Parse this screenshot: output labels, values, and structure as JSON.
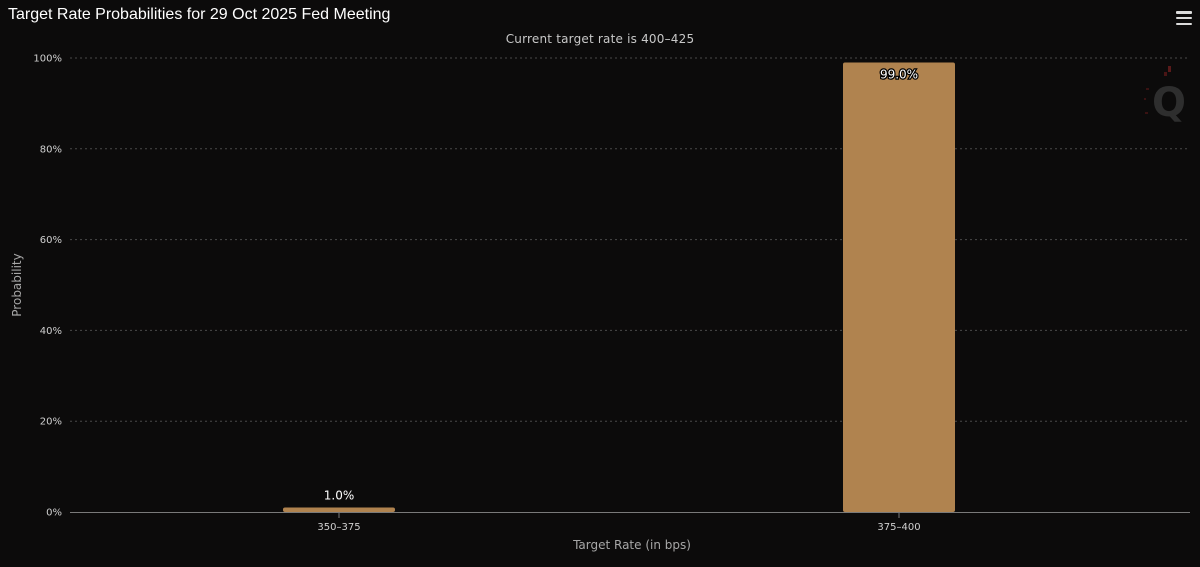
{
  "header": {
    "title": "Target Rate Probabilities for 29 Oct 2025 Fed Meeting",
    "subtitle": "Current target rate is 400–425",
    "menu_icon": "hamburger-menu-icon",
    "watermark_letter": "Q"
  },
  "colors": {
    "background": "#0c0b0b",
    "bar": "#b0834f",
    "grid": "#4a4a4a",
    "axis": "#7a7a7a"
  },
  "chart_data": {
    "type": "bar",
    "title": "Target Rate Probabilities for 29 Oct 2025 Fed Meeting",
    "subtitle": "Current target rate is 400–425",
    "xlabel": "Target Rate (in bps)",
    "ylabel": "Probability",
    "categories": [
      "350–375",
      "375–400"
    ],
    "values": [
      1.0,
      99.0
    ],
    "data_labels": [
      "1.0%",
      "99.0%"
    ],
    "ylim": [
      0,
      100
    ],
    "yticks": [
      0,
      20,
      40,
      60,
      80,
      100
    ],
    "ytick_labels": [
      "0%",
      "20%",
      "40%",
      "60%",
      "80%",
      "100%"
    ],
    "grid": true,
    "legend": "none"
  }
}
